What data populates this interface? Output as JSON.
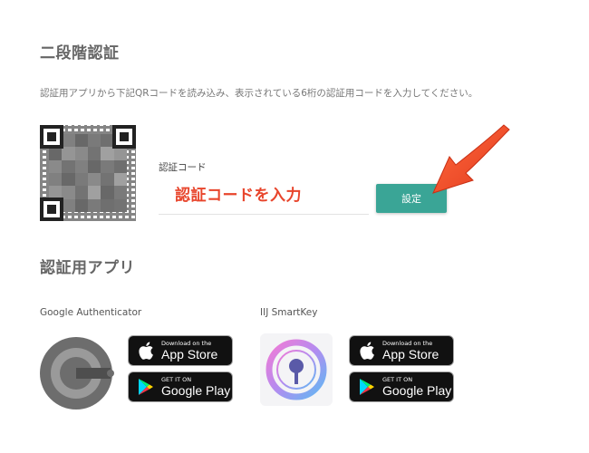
{
  "page": {
    "title": "二段階認証",
    "description": "認証用アプリから下記QRコードを読み込み、表示されている6桁の認証用コードを入力してください。"
  },
  "code_form": {
    "label": "認証コード",
    "overlay_annotation": "認証コードを入力",
    "submit_label": "設定"
  },
  "apps_section": {
    "title": "認証用アプリ",
    "apps": [
      {
        "name": "Google Authenticator",
        "icon": "google-authenticator-icon",
        "app_store": {
          "small": "Download on the",
          "big": "App Store"
        },
        "google_play": {
          "small": "GET IT ON",
          "big": "Google Play"
        }
      },
      {
        "name": "IIJ SmartKey",
        "icon": "iij-smartkey-icon",
        "app_store": {
          "small": "Download on the",
          "big": "App Store"
        },
        "google_play": {
          "small": "GET IT ON",
          "big": "Google Play"
        }
      }
    ]
  },
  "colors": {
    "accent_button": "#3aa596",
    "annotation_red": "#e8452c"
  }
}
